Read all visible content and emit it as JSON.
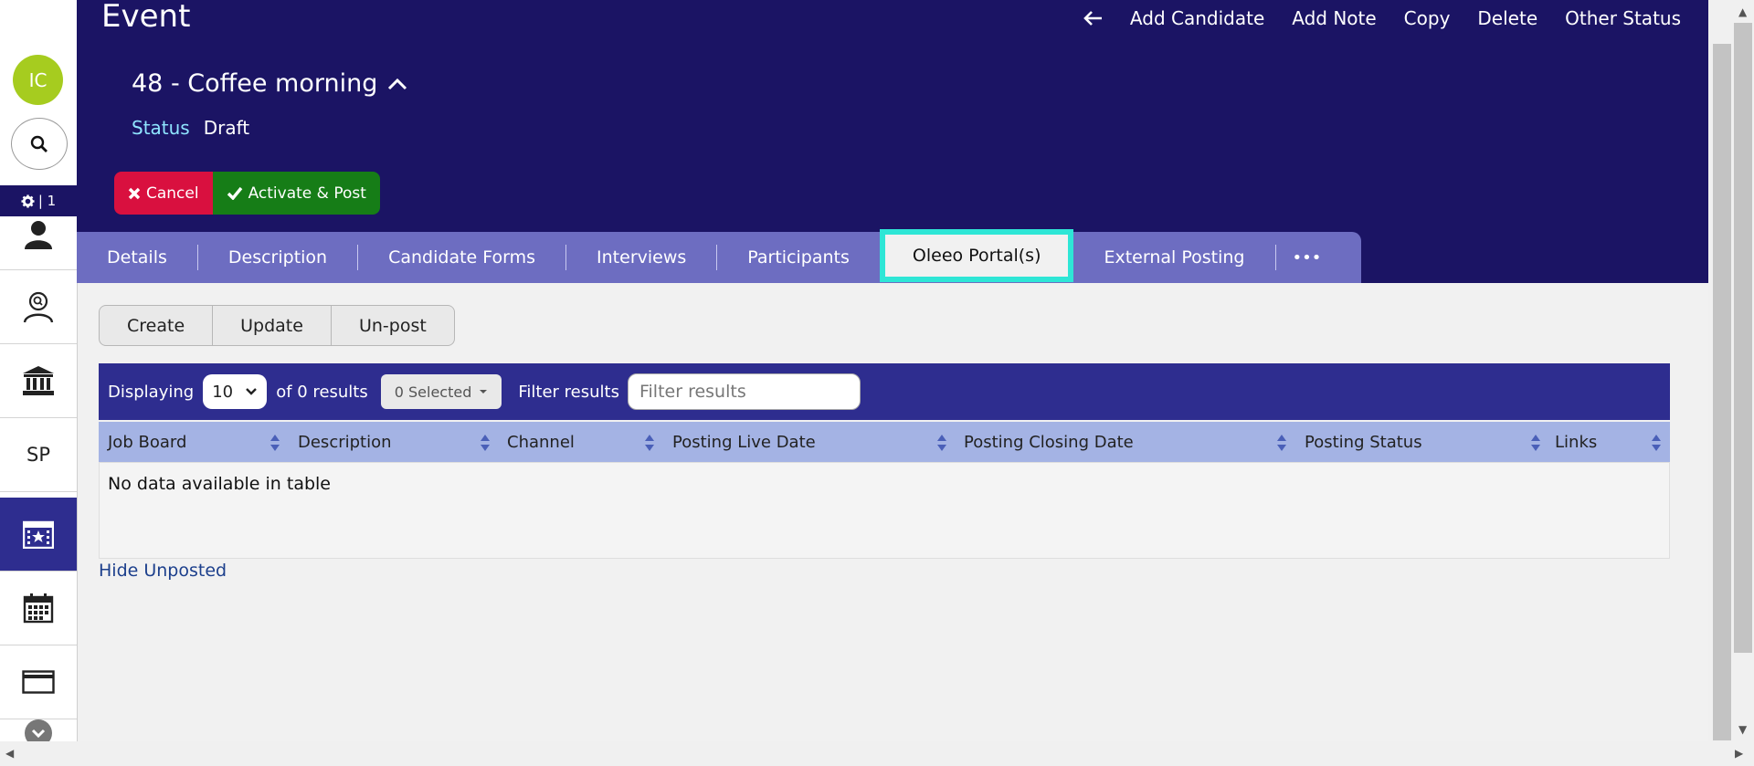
{
  "sidebar": {
    "avatar_initials": "IC",
    "gear_text": "| 1",
    "sp_label": "SP",
    "icons": [
      "person-icon",
      "candidate-search-icon",
      "bank-icon",
      "sp-item",
      "event-icon",
      "calendar-icon",
      "envelope-icon",
      "chevron-down-icon"
    ]
  },
  "header": {
    "title": "Event",
    "actions": {
      "add_candidate": "Add Candidate",
      "add_note": "Add Note",
      "copy": "Copy",
      "delete": "Delete",
      "other_status": "Other Status"
    },
    "event_title": "48 - Coffee morning",
    "status_label": "Status",
    "status_value": "Draft",
    "cancel_label": "Cancel",
    "activate_label": "Activate & Post"
  },
  "tabs": {
    "details": "Details",
    "description": "Description",
    "candidate_forms": "Candidate Forms",
    "interviews": "Interviews",
    "participants": "Participants",
    "oleeo_portals": "Oleeo Portal(s)",
    "external_posting": "External Posting",
    "more": "•••",
    "active": "Oleeo Portal(s)"
  },
  "toolbar": {
    "create": "Create",
    "update": "Update",
    "unpost": "Un-post"
  },
  "table": {
    "displaying_label": "Displaying",
    "page_size": "10",
    "results_text": "of 0 results",
    "selected_label": "0 Selected",
    "filter_label": "Filter results",
    "filter_placeholder": "Filter results",
    "columns": {
      "job_board": "Job Board",
      "description": "Description",
      "channel": "Channel",
      "posting_live_date": "Posting Live Date",
      "posting_closing_date": "Posting Closing Date",
      "posting_status": "Posting Status",
      "links": "Links"
    },
    "empty_message": "No data available in table"
  },
  "footer_link": "Hide Unposted",
  "colors": {
    "header_bg": "#1b1464",
    "tab_bar_bg": "#6d6dc1",
    "tab_highlight": "#2ee6d6",
    "cancel_bg": "#d9103f",
    "activate_bg": "#167d17",
    "table_toolbar_bg": "#2e2d8f",
    "table_head_bg": "#a4b3e4",
    "avatar_bg": "#a6cc1f",
    "status_label_color": "#8fe5ff",
    "link_color": "#1c3f8c"
  }
}
